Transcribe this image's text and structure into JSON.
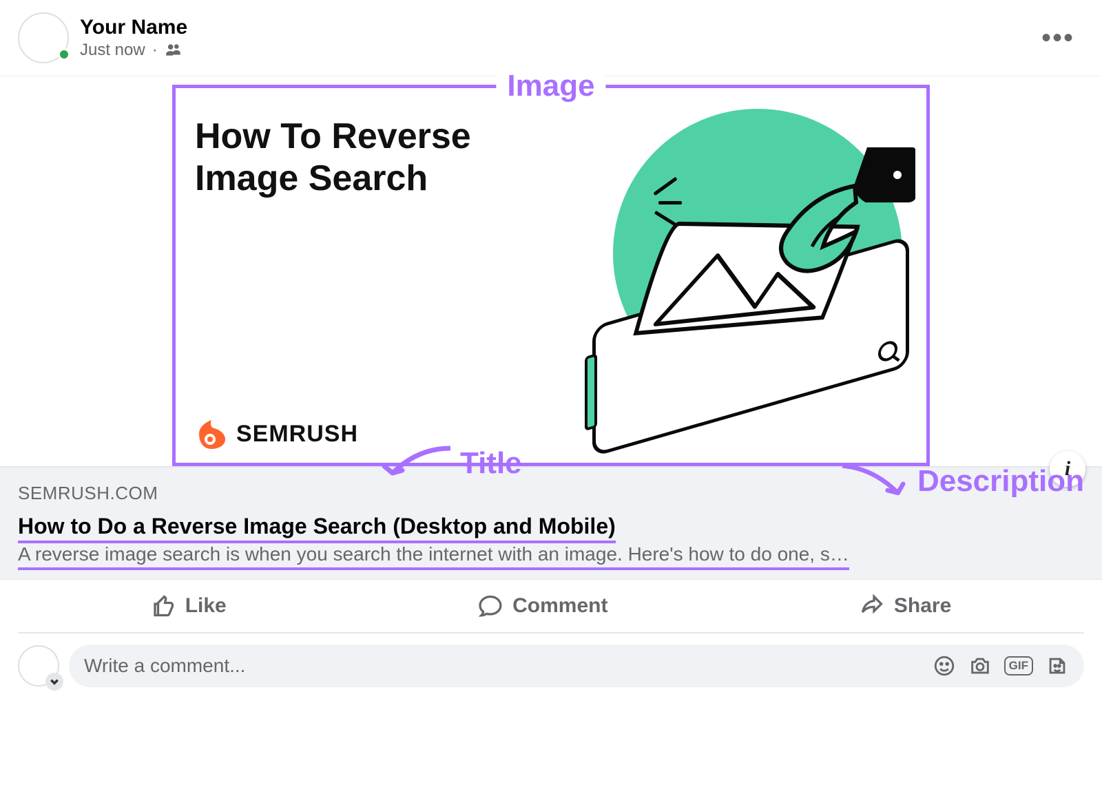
{
  "header": {
    "user_name": "Your Name",
    "timestamp": "Just now",
    "separator": "·"
  },
  "annotations": {
    "image_label": "Image",
    "title_label": "Title",
    "description_label": "Description"
  },
  "preview_image": {
    "headline_line1": "How To Reverse",
    "headline_line2": "Image Search",
    "brand_text": "SEMRUSH"
  },
  "link_card": {
    "domain": "SEMRUSH.COM",
    "title": "How to Do a Reverse Image Search (Desktop and Mobile)",
    "description": "A reverse image search is when you search the internet with an image. Here's how to do one, s…"
  },
  "actions": {
    "like": "Like",
    "comment": "Comment",
    "share": "Share"
  },
  "comment_box": {
    "placeholder": "Write a comment...",
    "gif_label": "GIF"
  },
  "colors": {
    "accent_purple": "#a970ff",
    "teal": "#4fd1a5",
    "semrush_orange": "#ff642d",
    "fb_gray": "#65676b"
  }
}
